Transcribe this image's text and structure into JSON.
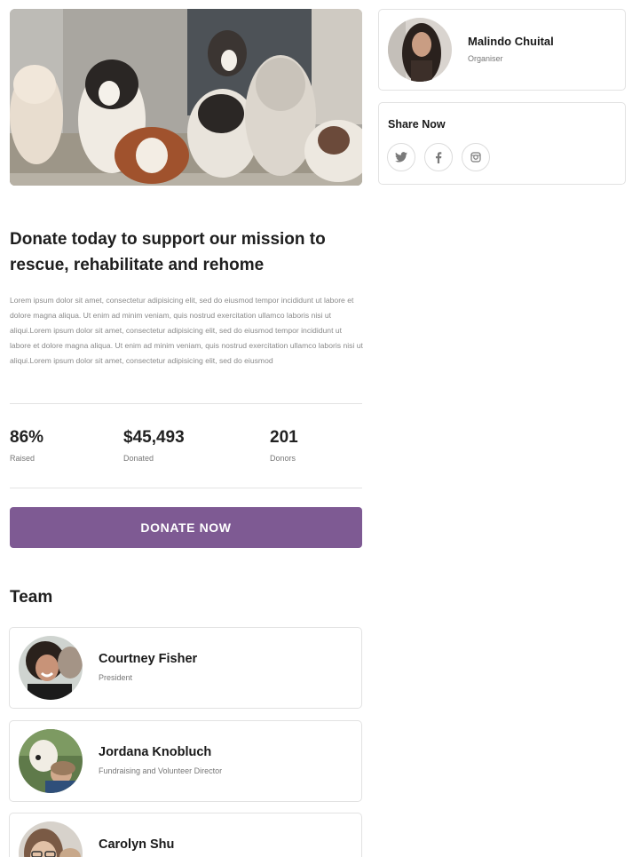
{
  "hero": {
    "image": "puppies-photo"
  },
  "organiser": {
    "name": "Malindo Chuital",
    "role": "Organiser",
    "avatar": "organiser-avatar-photo"
  },
  "share": {
    "title": "Share Now",
    "icons": [
      "twitter-icon",
      "facebook-icon",
      "instagram-icon"
    ]
  },
  "campaign": {
    "title": "Donate today to support our mission to rescue, rehabilitate and rehome",
    "description": "Lorem ipsum dolor sit amet, consectetur adipisicing elit, sed do eiusmod tempor incididunt ut labore et dolore magna aliqua. Ut enim ad minim veniam, quis nostrud exercitation ullamco laboris nisi ut aliqui.Lorem ipsum dolor sit amet, consectetur adipisicing elit, sed do eiusmod tempor incididunt ut labore et dolore magna aliqua. Ut enim ad minim veniam, quis nostrud exercitation ullamco laboris nisi ut aliqui.Lorem ipsum dolor sit amet, consectetur adipisicing elit, sed do eiusmod"
  },
  "stats": [
    {
      "value": "86%",
      "label": "Raised"
    },
    {
      "value": "$45,493",
      "label": "Donated"
    },
    {
      "value": "201",
      "label": "Donors"
    }
  ],
  "donate_button": {
    "label": "DONATE NOW",
    "color": "#7e5a93"
  },
  "team": {
    "heading": "Team",
    "members": [
      {
        "name": "Courtney Fisher",
        "role": "President"
      },
      {
        "name": "Jordana Knobluch",
        "role": "Fundraising and Volunteer Director"
      },
      {
        "name": "Carolyn Shu",
        "role": ""
      }
    ]
  }
}
